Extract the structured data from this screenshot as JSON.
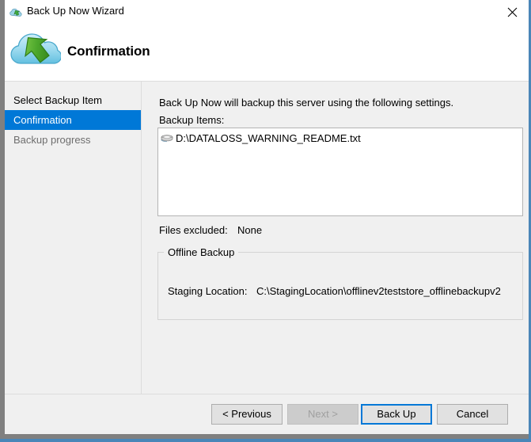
{
  "window": {
    "title": "Back Up Now Wizard",
    "title_icon": "cloud-backup-icon",
    "close_icon": "close-icon"
  },
  "banner": {
    "icon": "cloud-upload-arrow-icon",
    "title": "Confirmation"
  },
  "sidebar": {
    "items": [
      {
        "label": "Select Backup Item",
        "state": "completed"
      },
      {
        "label": "Confirmation",
        "state": "selected"
      },
      {
        "label": "Backup progress",
        "state": "disabled"
      }
    ]
  },
  "content": {
    "intro_text": "Back Up Now will backup this server using the following settings.",
    "backup_items_label": "Backup Items:",
    "backup_items": [
      {
        "icon": "disk-drive-icon",
        "path": "D:\\DATALOSS_WARNING_README.txt"
      }
    ],
    "files_excluded_label": "Files excluded:",
    "files_excluded_value": "None",
    "offline_backup": {
      "legend": "Offline Backup",
      "staging_location_label": "Staging Location:",
      "staging_location_value": "C:\\StagingLocation\\offlinev2teststore_offlinebackupv2"
    }
  },
  "footer": {
    "previous_label": "< Previous",
    "next_label": "Next >",
    "backup_label": "Back Up",
    "cancel_label": "Cancel"
  },
  "colors": {
    "accent": "#0078D7",
    "window_chrome": "#808080",
    "dialog_background": "#F0F0F0",
    "bottom_strip": "#4A86B8"
  }
}
